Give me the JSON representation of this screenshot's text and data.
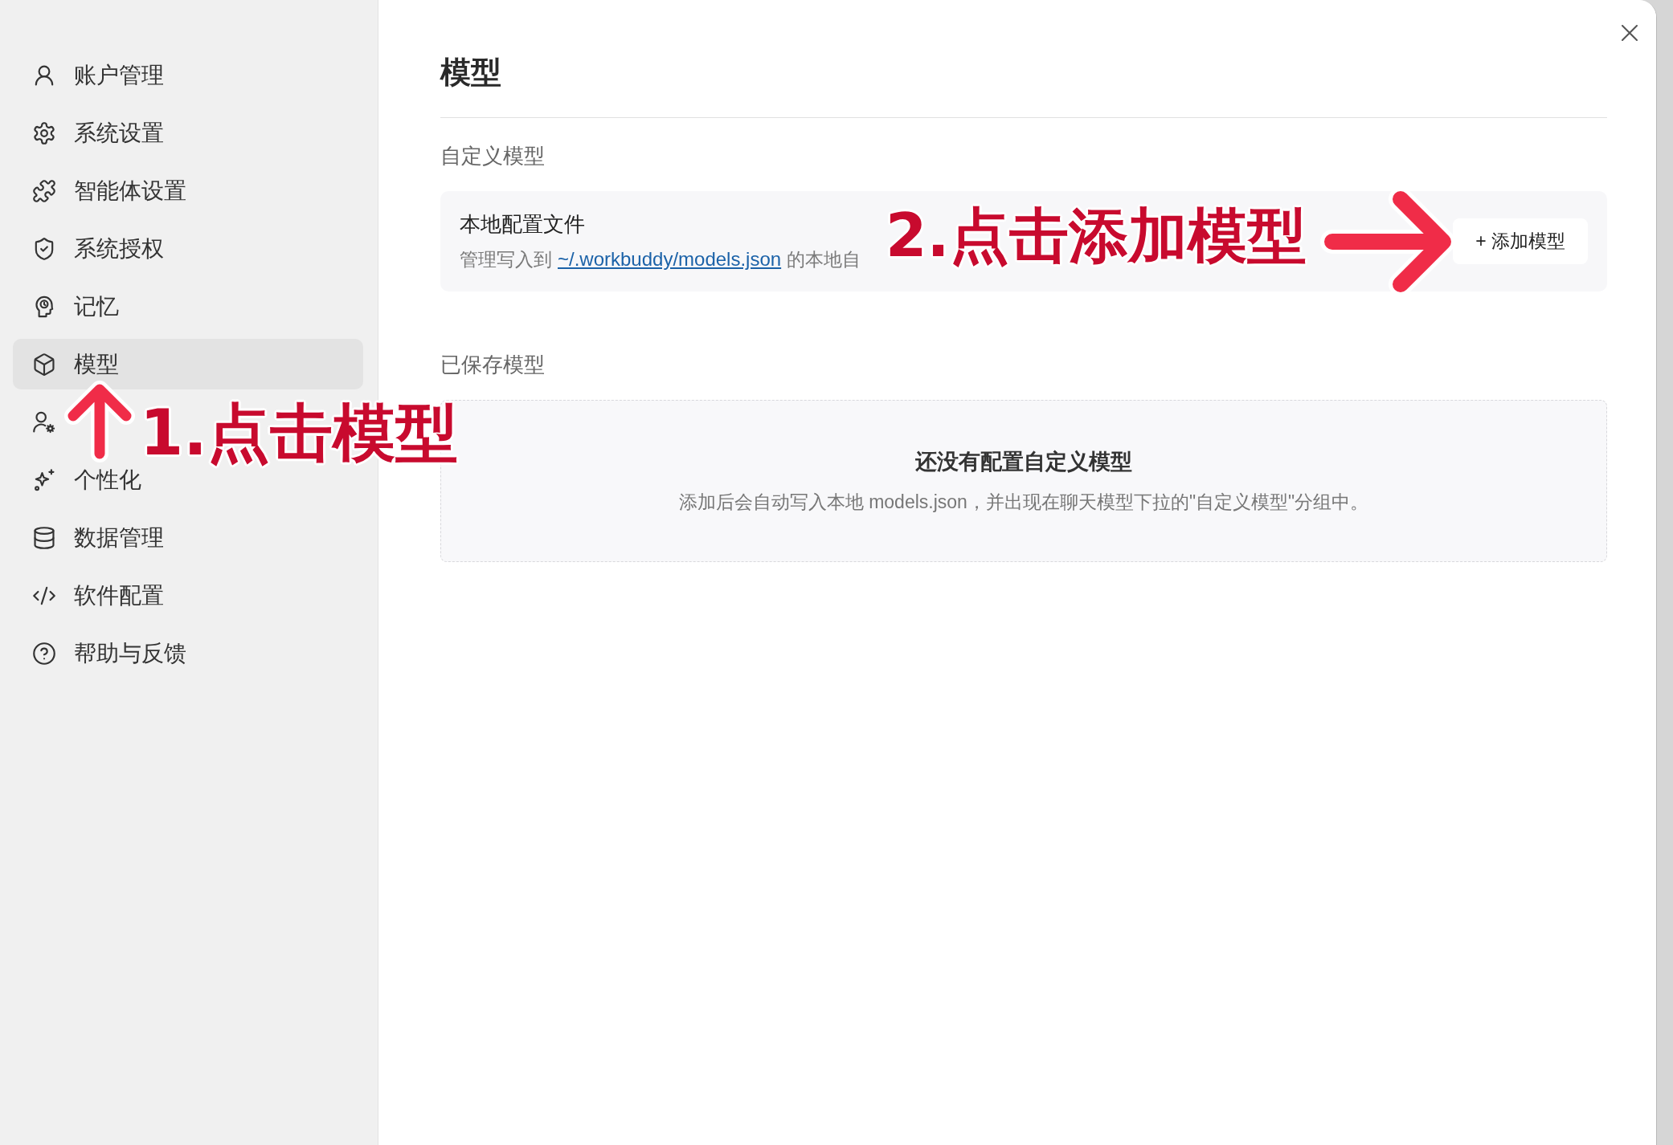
{
  "sidebar": {
    "items": [
      {
        "label": "账户管理",
        "selected": false
      },
      {
        "label": "系统设置",
        "selected": false
      },
      {
        "label": "智能体设置",
        "selected": false
      },
      {
        "label": "系统授权",
        "selected": false
      },
      {
        "label": "记忆",
        "selected": false
      },
      {
        "label": "模型",
        "selected": true
      },
      {
        "selected": false
      },
      {
        "label": "个性化",
        "selected": false
      },
      {
        "label": "数据管理",
        "selected": false
      },
      {
        "label": "软件配置",
        "selected": false
      },
      {
        "label": "帮助与反馈",
        "selected": false
      }
    ]
  },
  "page": {
    "title": "模型"
  },
  "custom_models": {
    "heading": "自定义模型",
    "card": {
      "title": "本地配置文件",
      "description": "管理写入到",
      "link": "~/.workbuddy/models.json",
      "description_end": "的本地自"
    },
    "add_button": "+ 添加模型"
  },
  "saved_models": {
    "heading": "已保存模型",
    "empty_state": {
      "title": "还没有配置自定义模型",
      "message": "添加后会自动写入本地 models.json，并出现在聊天模型下拉的\"自定义模型\"分组中。"
    }
  },
  "annotations": [
    {
      "kind": "up",
      "text": "1.点击模型"
    },
    {
      "kind": "right",
      "text": "2.点击添加模型"
    }
  ]
}
